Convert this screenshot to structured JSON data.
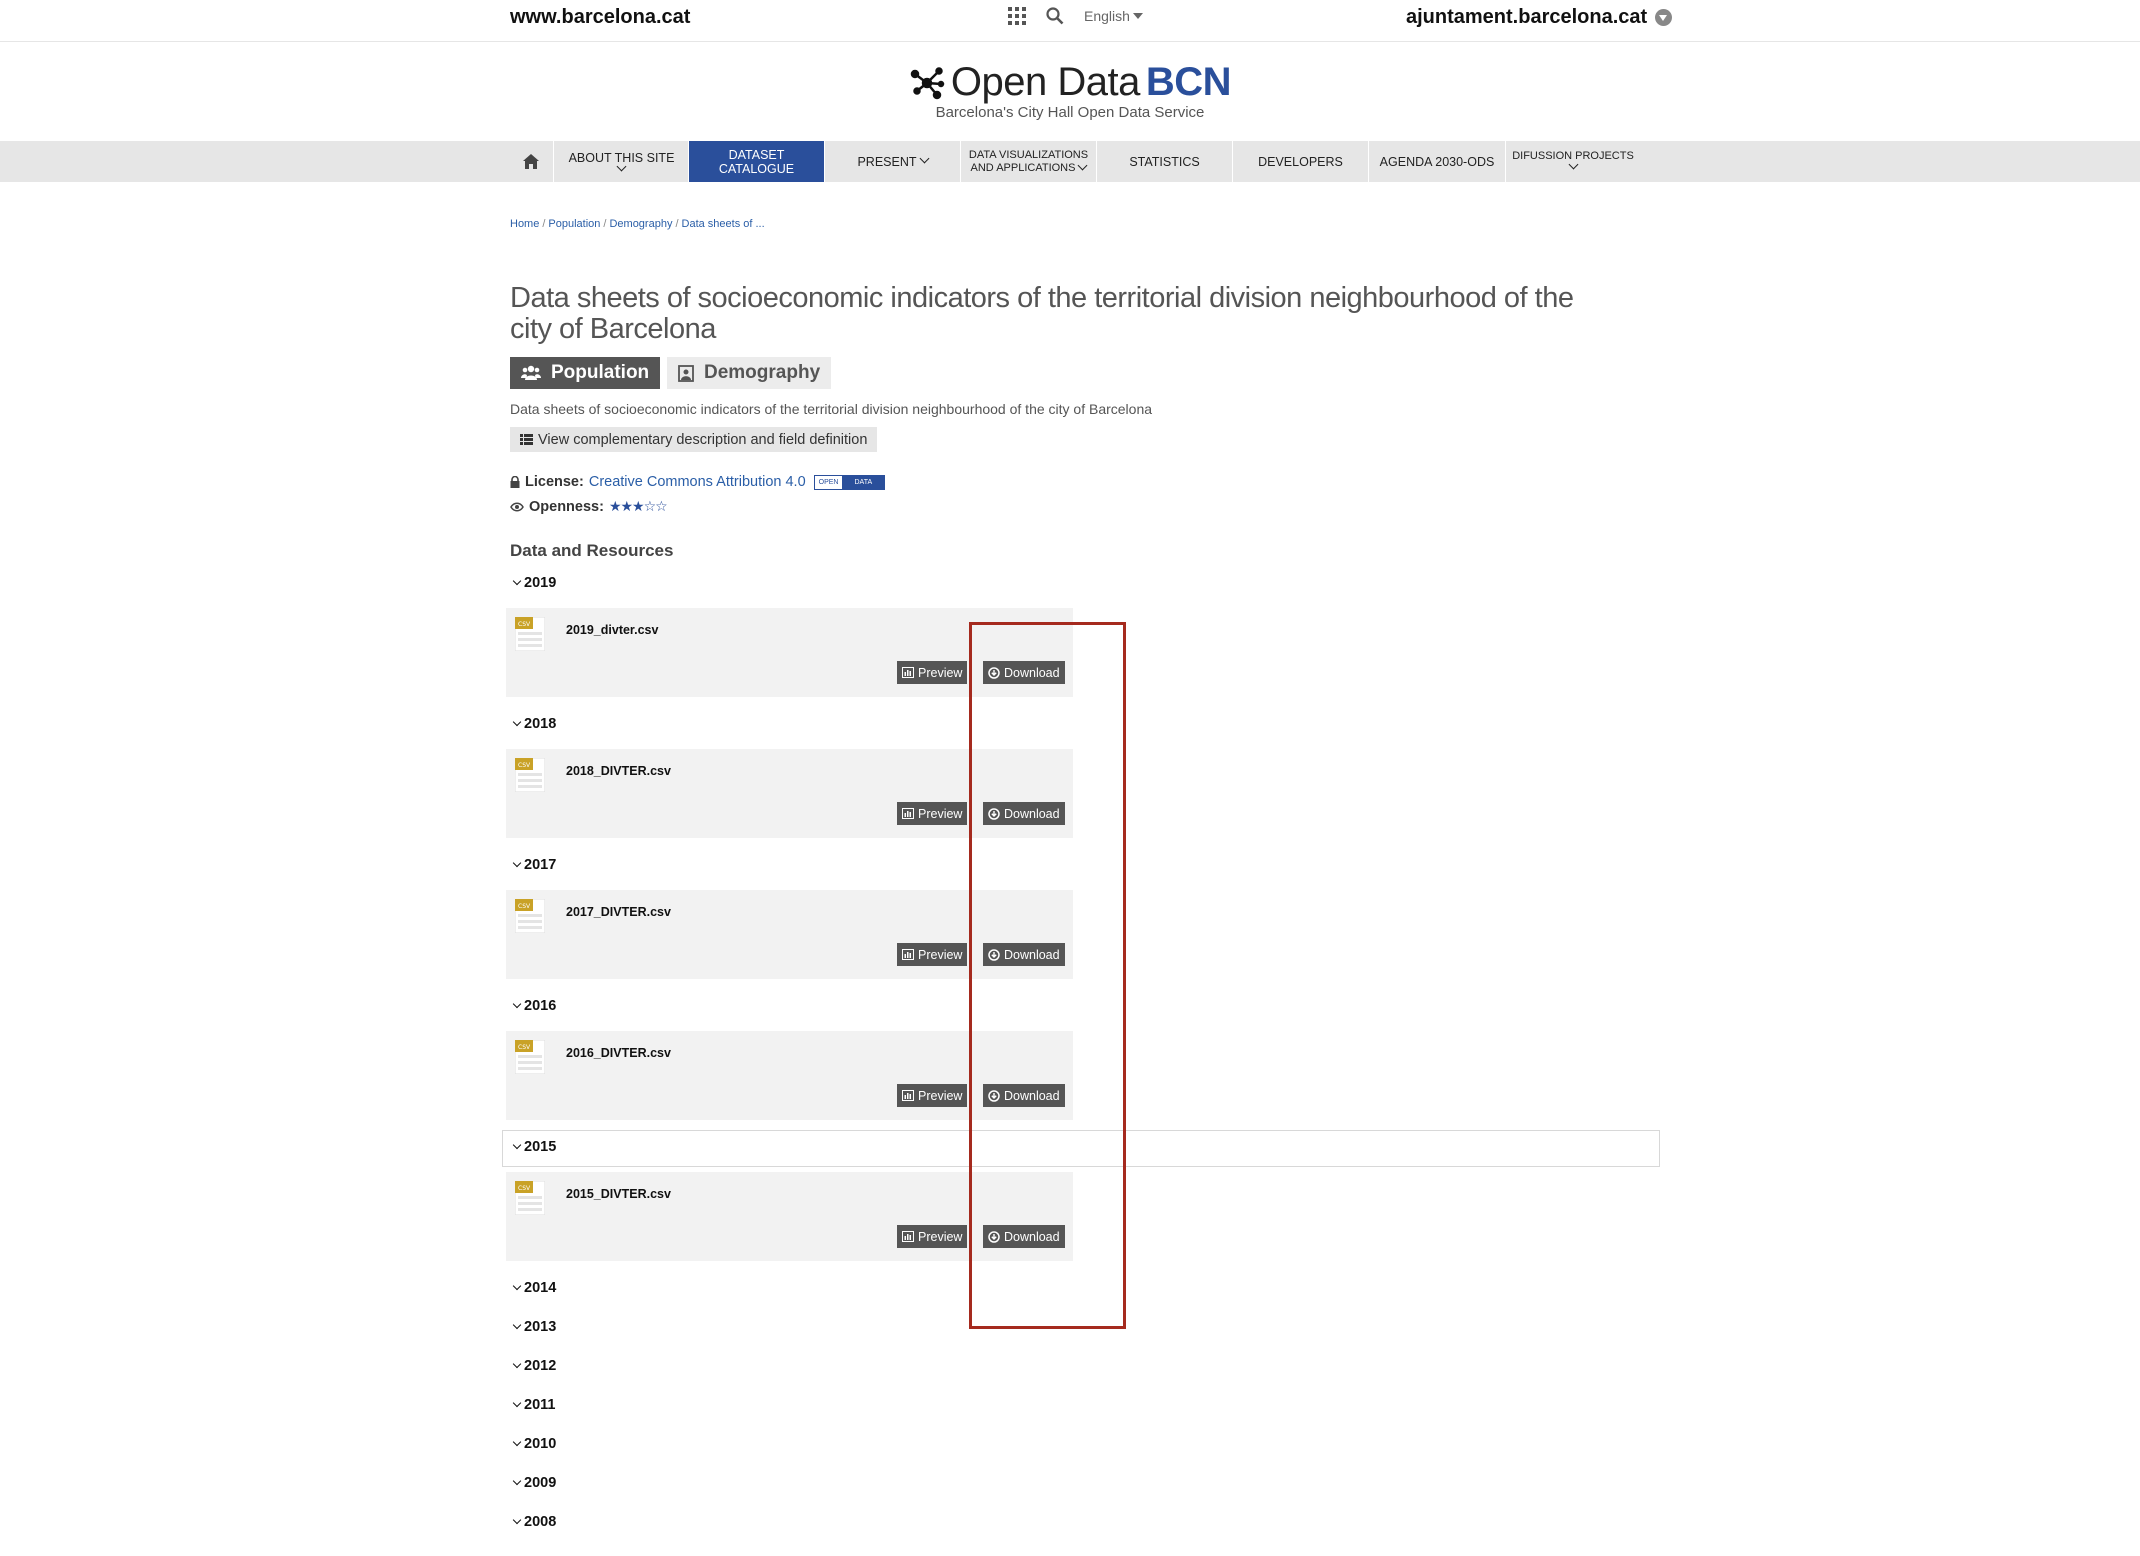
{
  "topbar": {
    "site_link": "www.barcelona.cat",
    "language": "English",
    "ajuntament_link": "ajuntament.barcelona.cat"
  },
  "logo": {
    "title_prefix": "Open Data",
    "title_brand": "BCN",
    "subtitle": "Barcelona's City Hall Open Data Service"
  },
  "nav": {
    "about": "ABOUT THIS SITE",
    "catalogue_1": "DATASET",
    "catalogue_2": "CATALOGUE",
    "present": "PRESENT",
    "dataviz_1": "DATA VISUALIZATIONS",
    "dataviz_2": "AND APPLICATIONS",
    "statistics": "STATISTICS",
    "developers": "DEVELOPERS",
    "agenda": "AGENDA 2030-ODS",
    "difussion": "DIFUSSION PROJECTS"
  },
  "breadcrumb": [
    "Home",
    "Population",
    "Demography",
    "Data sheets of ..."
  ],
  "page": {
    "title": "Data sheets of socioeconomic indicators of the territorial division neighbourhood of the city of Barcelona",
    "tag_population": "Population",
    "tag_demography": "Demography",
    "description": "Data sheets of socioeconomic indicators of the territorial division neighbourhood of the city of Barcelona",
    "complementary": "View complementary description and field definition",
    "license_label": "License:",
    "license_value": "Creative Commons Attribution 4.0",
    "badge_open": "OPEN",
    "badge_data": "DATA",
    "openness_label": "Openness:",
    "openness_stars": "★★★☆☆",
    "resources_title": "Data and Resources"
  },
  "years": [
    "2019",
    "2018",
    "2017",
    "2016",
    "2015",
    "2014",
    "2013",
    "2012",
    "2011",
    "2010",
    "2009",
    "2008"
  ],
  "resources": [
    {
      "name": "2019_divter.csv"
    },
    {
      "name": "2018_DIVTER.csv"
    },
    {
      "name": "2017_DIVTER.csv"
    },
    {
      "name": "2016_DIVTER.csv"
    },
    {
      "name": "2015_DIVTER.csv"
    }
  ],
  "buttons": {
    "preview": "Preview",
    "download": "Download"
  },
  "csv_icon_label": "CSV",
  "colors": {
    "brand_blue": "#2a4f9b",
    "highlight_red": "#a52a1e",
    "button_gray": "#555555"
  }
}
